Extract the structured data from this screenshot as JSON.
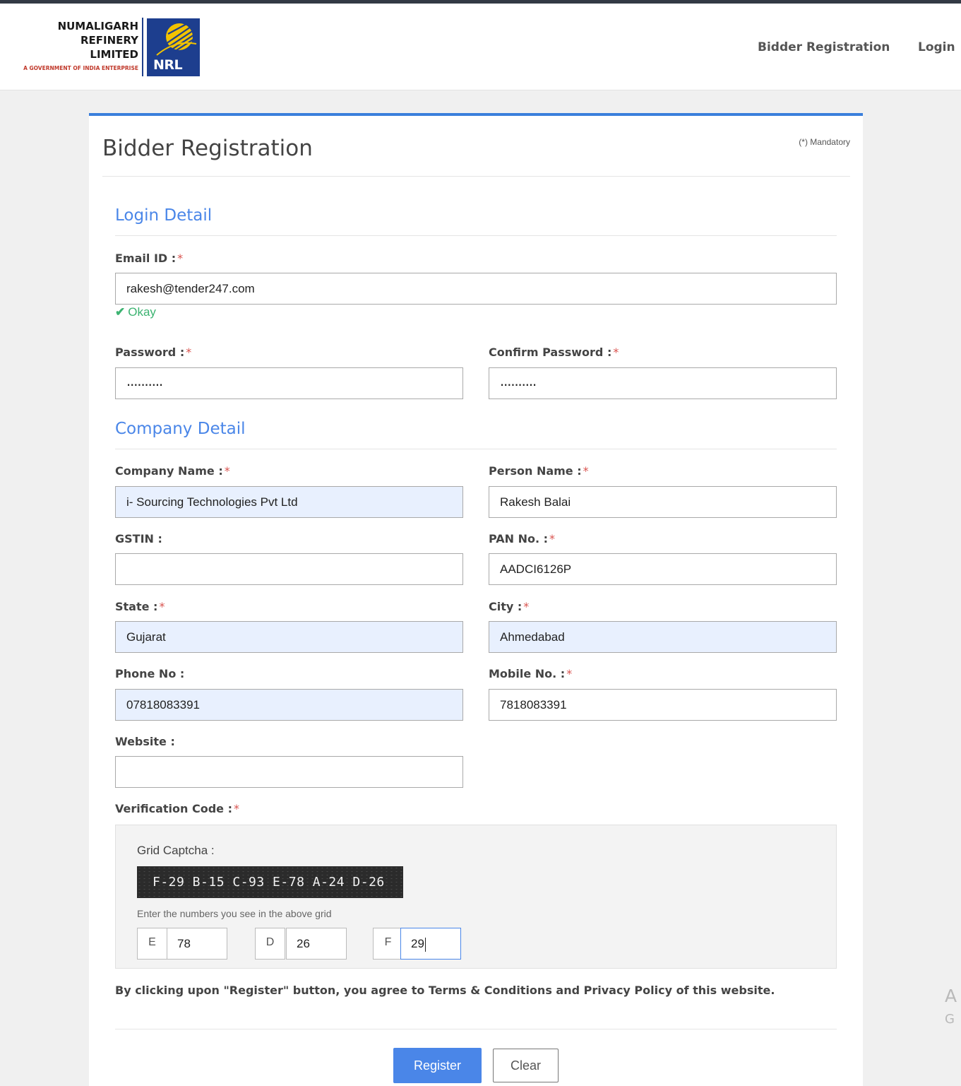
{
  "header": {
    "logo_line1": "NUMALIGARH",
    "logo_line2": "REFINERY",
    "logo_line3": "LIMITED",
    "logo_tagline": "A GOVERNMENT OF INDIA ENTERPRISE",
    "logo_mark": "NRL",
    "nav": {
      "bidder_registration": "Bidder Registration",
      "login": "Login"
    }
  },
  "form": {
    "title": "Bidder Registration",
    "mandatory_note": "(*) Mandatory",
    "req_marker": "*",
    "login_section": {
      "title": "Login Detail",
      "email_label": "Email ID :",
      "email_value": "rakesh@tender247.com",
      "email_status": "Okay",
      "password_label": "Password :",
      "password_value": "..........",
      "confirm_password_label": "Confirm Password :",
      "confirm_password_value": ".........."
    },
    "company_section": {
      "title": "Company Detail",
      "company_name_label": "Company Name :",
      "company_name_value": "i- Sourcing Technologies Pvt Ltd",
      "person_name_label": "Person Name :",
      "person_name_value": "Rakesh Balai",
      "gstin_label": "GSTIN :",
      "gstin_value": "",
      "pan_label": "PAN No. :",
      "pan_value": "AADCI6126P",
      "state_label": "State :",
      "state_value": "Gujarat",
      "city_label": "City :",
      "city_value": "Ahmedabad",
      "phone_label": "Phone No :",
      "phone_value": "07818083391",
      "mobile_label": "Mobile No. :",
      "mobile_value": "7818083391",
      "website_label": "Website :",
      "website_value": ""
    },
    "verification": {
      "label": "Verification Code :",
      "grid_captcha_label": "Grid Captcha :",
      "captcha_text": "F-29 B-15 C-93 E-78 A-24 D-26",
      "hint": "Enter the numbers you see in the above grid",
      "fields": [
        {
          "prefix": "E",
          "value": "78"
        },
        {
          "prefix": "D",
          "value": "26"
        },
        {
          "prefix": "F",
          "value": "29"
        }
      ]
    },
    "agreement": "By clicking upon \"Register\" button, you agree to Terms & Conditions and Privacy Policy of this website.",
    "register_button": "Register",
    "clear_button": "Clear"
  },
  "watermark": {
    "line1": "A",
    "line2": "G"
  },
  "colors": {
    "accent": "#4a86e8",
    "required": "#d9534f",
    "success": "#3cb371",
    "autofill": "#e8f0fe"
  }
}
